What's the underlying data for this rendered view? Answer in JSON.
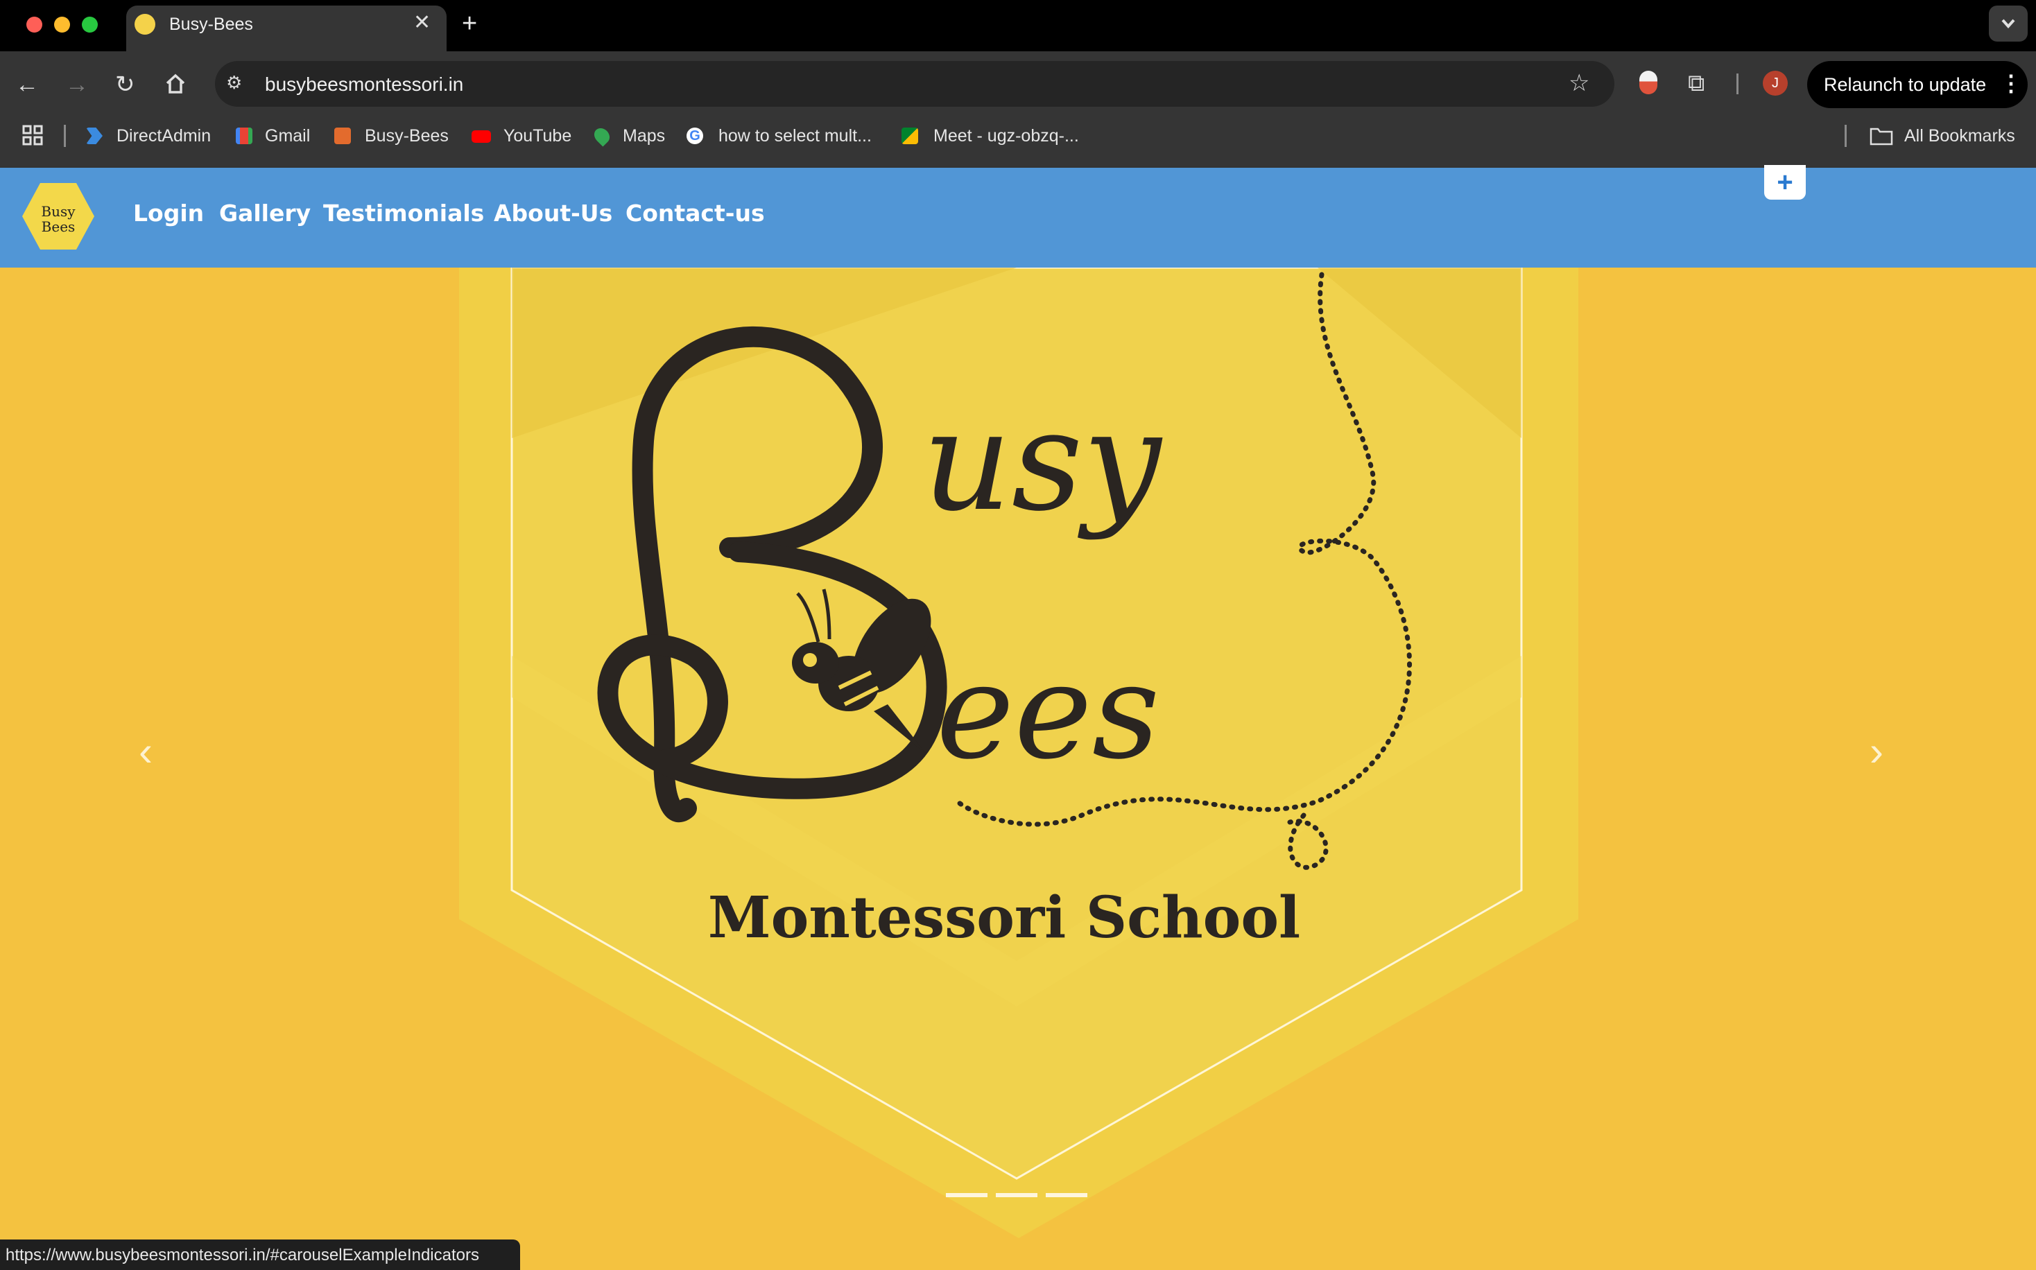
{
  "browser": {
    "tab_title": "Busy-Bees",
    "url": "busybeesmontessori.in",
    "relaunch_label": "Relaunch to update",
    "avatar_initial": "J",
    "bookmarks": [
      "DirectAdmin",
      "Gmail",
      "Busy-Bees",
      "YouTube",
      "Maps",
      "how to select mult...",
      "Meet - ugz-obzq-..."
    ],
    "all_bookmarks": "All Bookmarks",
    "status_url": "https://www.busybeesmontessori.in/#carouselExampleIndicators"
  },
  "site": {
    "nav_links": [
      "Login",
      "Gallery",
      "Testimonials",
      "About-Us",
      "Contact-us"
    ],
    "logo_text_line1": "Busy",
    "logo_text_line2": "Bees",
    "logo_tagline": "Montessori School"
  },
  "carousel": {
    "slide_count": 3,
    "active_slide": 1
  },
  "colors": {
    "nav_bg": "#5196d6",
    "page_bg": "#f4c240",
    "banner": "#f1cf45"
  }
}
